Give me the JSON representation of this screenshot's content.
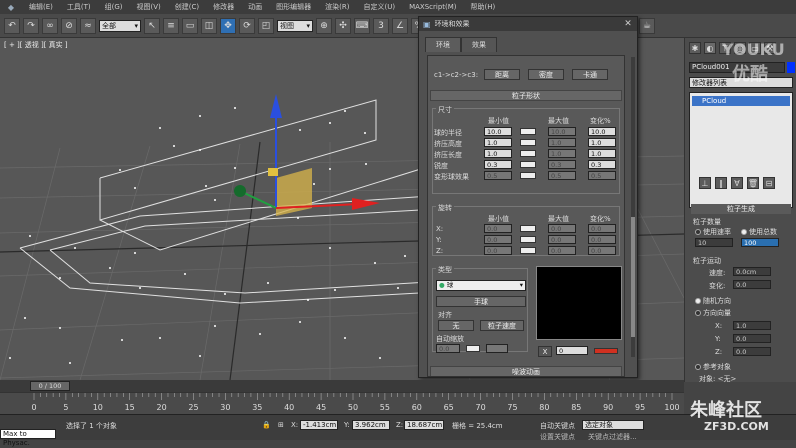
{
  "menubar": {
    "items": [
      "编辑(E)",
      "工具(T)",
      "组(G)",
      "视图(V)",
      "创建(C)",
      "修改器",
      "动画",
      "图形编辑器",
      "渲染(R)",
      "自定义(U)",
      "MAXScript(M)",
      "帮助(H)"
    ]
  },
  "toolbar": {
    "filter_select": "全部",
    "coord_select": "视图"
  },
  "viewport": {
    "label": "[ + ][ 透视 ][ 真实 ]"
  },
  "dialog": {
    "title": "环境和效果",
    "tabs": [
      "环境",
      "效果"
    ],
    "pipeline_label": "c1->c2->c3:",
    "pipeline_buttons": [
      "距离",
      "密度",
      "卡通"
    ],
    "shape_rollout": "粒子形状",
    "size_group": {
      "title": "尺寸",
      "col_min": "最小值",
      "col_max": "最大值",
      "col_var": "变化%",
      "rows": [
        {
          "label": "球的半径",
          "min": "10.0",
          "max": "10.0",
          "var": "10.0"
        },
        {
          "label": "挤压高度",
          "min": "1.0",
          "max": "1.0",
          "var": "1.0"
        },
        {
          "label": "挤压长度",
          "min": "1.0",
          "max": "1.0",
          "var": "1.0"
        },
        {
          "label": "锐度",
          "min": "0.3",
          "max": "0.3",
          "var": "0.3"
        },
        {
          "label": "变形球效果",
          "min": "0.5",
          "max": "0.5",
          "var": "0.5"
        }
      ]
    },
    "rotation_group": {
      "title": "旋转",
      "col_min": "最小值",
      "col_max": "最大值",
      "col_var": "变化%",
      "rows": [
        {
          "label": "X:",
          "min": "0.0",
          "max": "0.0",
          "var": "0.0"
        },
        {
          "label": "Y:",
          "min": "0.0",
          "max": "0.0",
          "var": "0.0"
        },
        {
          "label": "Z:",
          "min": "0.0",
          "max": "0.0",
          "var": "0.0"
        }
      ]
    },
    "type_group": {
      "title": "类型",
      "type_select": "球",
      "sphere_button": "手球",
      "align_label": "对齐",
      "align_none": "无",
      "align_speed": "粒子速度",
      "auto_scale_label": "自动缩放",
      "auto_scale_value": "0.0",
      "preview_x": "X",
      "preview_value": "0"
    },
    "bottom_rollout": "噪波动画"
  },
  "cmdpanel": {
    "object_name": "PCloud001",
    "modifier_list": "修改器列表",
    "stack_item": "PCloud",
    "rollout_title": "粒子生成",
    "qty_label": "粒子数量",
    "use_rate": "使用速率",
    "use_total": "使用总数",
    "rate_value": "10",
    "total_value": "100",
    "motion_label": "粒子运动",
    "speed_label": "速度:",
    "speed_value": "0.0cm",
    "var_label": "变化:",
    "var_value": "0.0",
    "random_dir": "随机方向",
    "dir_vector": "方向向量",
    "x_label": "X:",
    "y_label": "Y:",
    "z_label": "Z:",
    "x_value": "1.0",
    "y_value": "0.0",
    "z_value": "0.0",
    "ref_object": "参考对象",
    "object_label": "对象: <无>"
  },
  "timeline": {
    "frame_label": "0 / 100",
    "ticks": [
      "0",
      "5",
      "10",
      "15",
      "20",
      "25",
      "30",
      "35",
      "40",
      "45",
      "50",
      "55",
      "60",
      "65",
      "70",
      "75",
      "80",
      "85",
      "90",
      "95",
      "100"
    ]
  },
  "statusbar": {
    "status_text": "选择了 1 个对象",
    "script_text": "Max to Physac.",
    "x_label": "X:",
    "x_value": "-1.413cm",
    "y_label": "Y:",
    "y_value": "3.962cm",
    "z_label": "Z:",
    "z_value": "18.687cm",
    "grid_label": "栅格 = 25.4cm",
    "autokey_label": "自动关键点",
    "set_key_label": "设置关键点",
    "selected_object": "选定对象",
    "filter_label": "关键点过滤器..."
  },
  "watermarks": {
    "youku_top": "YOUKU",
    "youku_bottom": "优酷",
    "zhufeng": "朱峰社区",
    "zhufeng_url": "ZF3D.COM"
  }
}
